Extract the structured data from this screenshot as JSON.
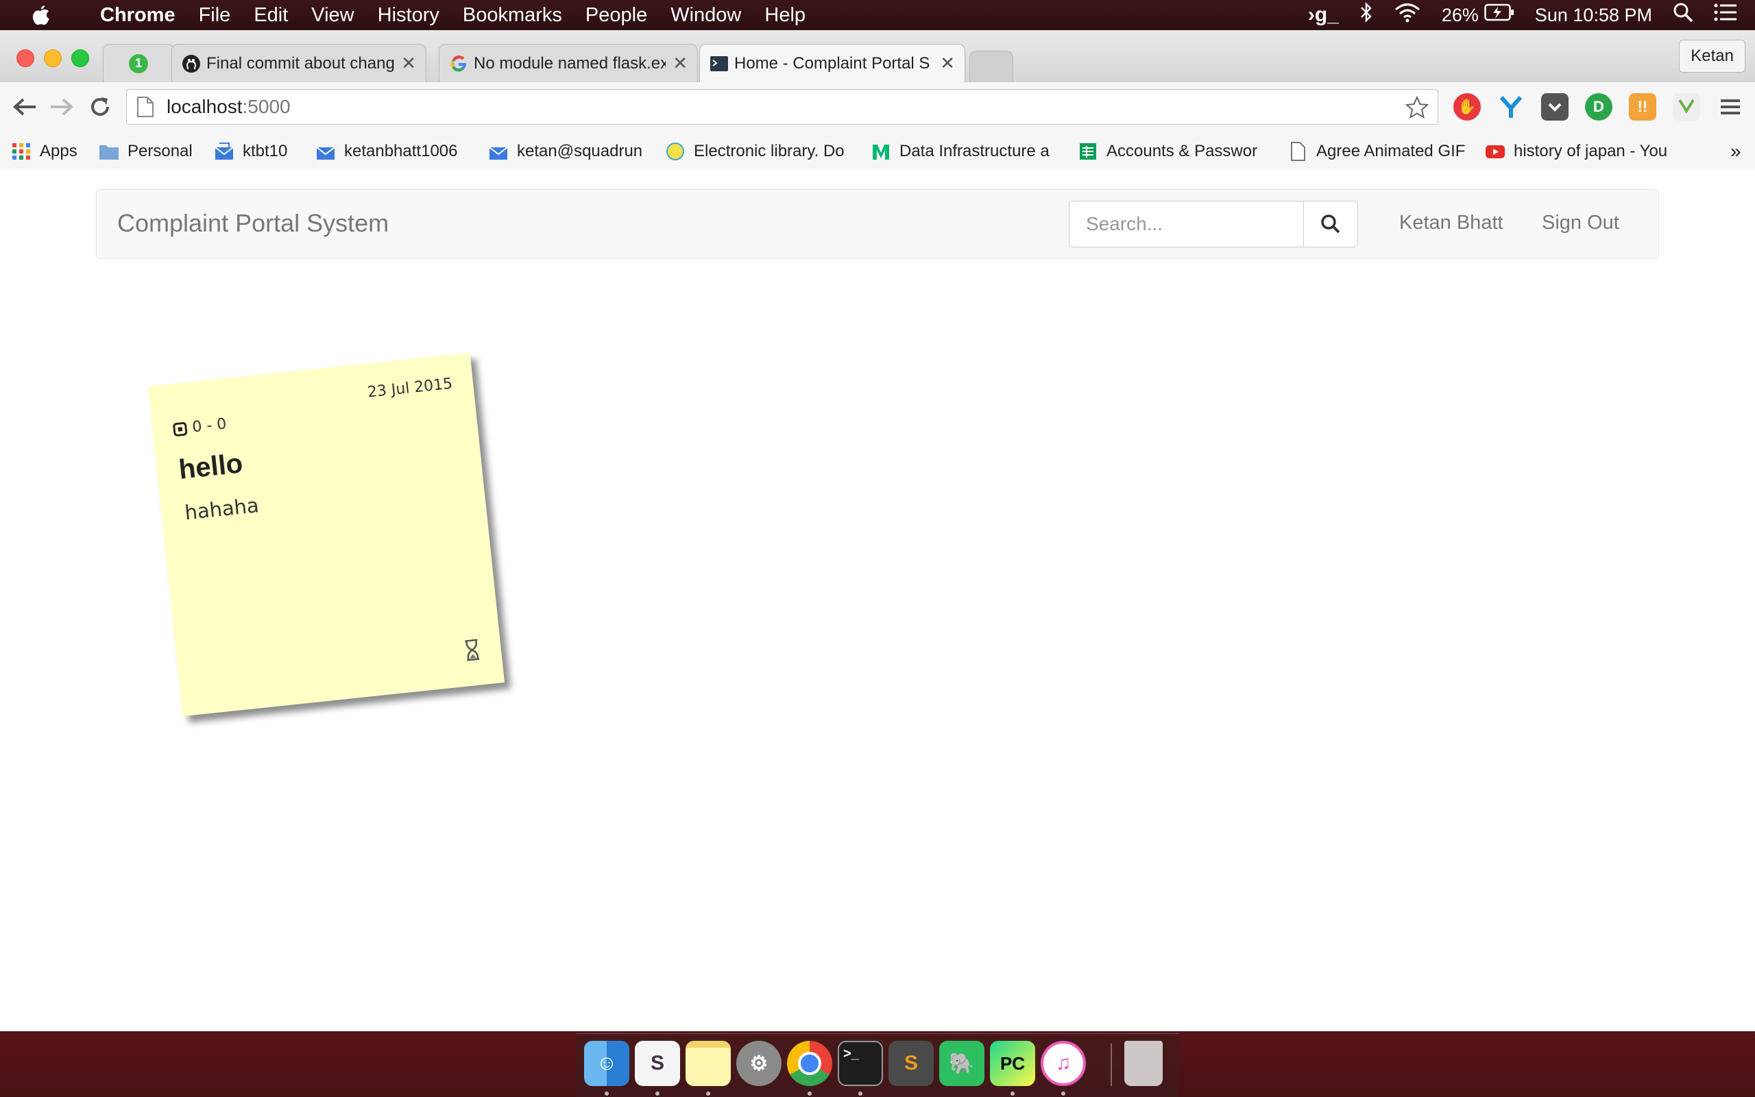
{
  "menubar": {
    "app_name": "Chrome",
    "menus": [
      "File",
      "Edit",
      "View",
      "History",
      "Bookmarks",
      "People",
      "Window",
      "Help"
    ],
    "battery": "26%",
    "clock": "Sun 10:58 PM"
  },
  "browser": {
    "tabs": [
      {
        "title": "",
        "badge": "1"
      },
      {
        "title": "Final commit about change"
      },
      {
        "title": "No module named flask.ext"
      },
      {
        "title": "Home - Complaint Portal S",
        "active": true
      }
    ],
    "profile": "Ketan",
    "url_host": "localhost",
    "url_port": ":5000",
    "bookmarks": [
      "Apps",
      "Personal",
      "ktbt10",
      "ketanbhatt1006",
      "ketan@squadrun",
      "Electronic library. Do",
      "Data Infrastructure a",
      "Accounts & Passwor",
      "Agree Animated GIF",
      "history of japan - You"
    ],
    "overflow": "»"
  },
  "navbar": {
    "brand": "Complaint Portal System",
    "search_placeholder": "Search...",
    "user": "Ketan Bhatt",
    "signout": "Sign Out"
  },
  "note": {
    "votes": "0 - 0",
    "date": "23 Jul 2015",
    "title": "hello",
    "body": "hahaha"
  },
  "dock": {
    "apps": [
      "Finder",
      "Slack",
      "Notes",
      "System Preferences",
      "Chrome",
      "Terminal",
      "Sublime Text",
      "Evernote",
      "PyCharm",
      "iTunes",
      "Trash"
    ]
  }
}
